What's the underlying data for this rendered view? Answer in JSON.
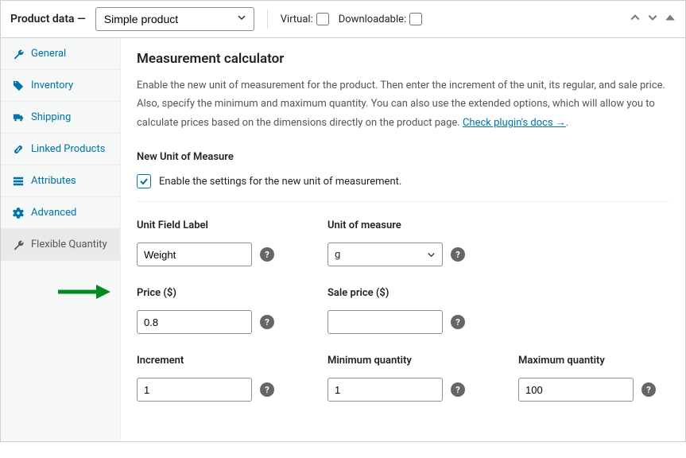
{
  "header": {
    "title": "Product data —",
    "product_type": "Simple product",
    "virtual_label": "Virtual:",
    "downloadable_label": "Downloadable:"
  },
  "sidebar": {
    "items": [
      {
        "label": "General"
      },
      {
        "label": "Inventory"
      },
      {
        "label": "Shipping"
      },
      {
        "label": "Linked Products"
      },
      {
        "label": "Attributes"
      },
      {
        "label": "Advanced"
      },
      {
        "label": "Flexible Quantity"
      }
    ]
  },
  "content": {
    "heading": "Measurement calculator",
    "desc_before_link": "Enable the new unit of measurement for the product. Then enter the increment of the unit, its regular, and sale price. Also, specify the minimum and maximum quantity. You can also use the extended options, which will allow you to calculate prices based on the dimensions directly on the product page. ",
    "link_text": "Check plugin's docs →",
    "desc_after": ".",
    "section_title": "New Unit of Measure",
    "enable_checkbox_label": "Enable the settings for the new unit of measurement.",
    "fields": {
      "unit_label": {
        "label": "Unit Field Label",
        "value": "Weight"
      },
      "unit_measure": {
        "label": "Unit of measure",
        "value": "g"
      },
      "price": {
        "label": "Price ($)",
        "value": "0.8"
      },
      "sale_price": {
        "label": "Sale price ($)",
        "value": ""
      },
      "increment": {
        "label": "Increment",
        "value": "1"
      },
      "min_qty": {
        "label": "Minimum quantity",
        "value": "1"
      },
      "max_qty": {
        "label": "Maximum quantity",
        "value": "100"
      }
    }
  }
}
